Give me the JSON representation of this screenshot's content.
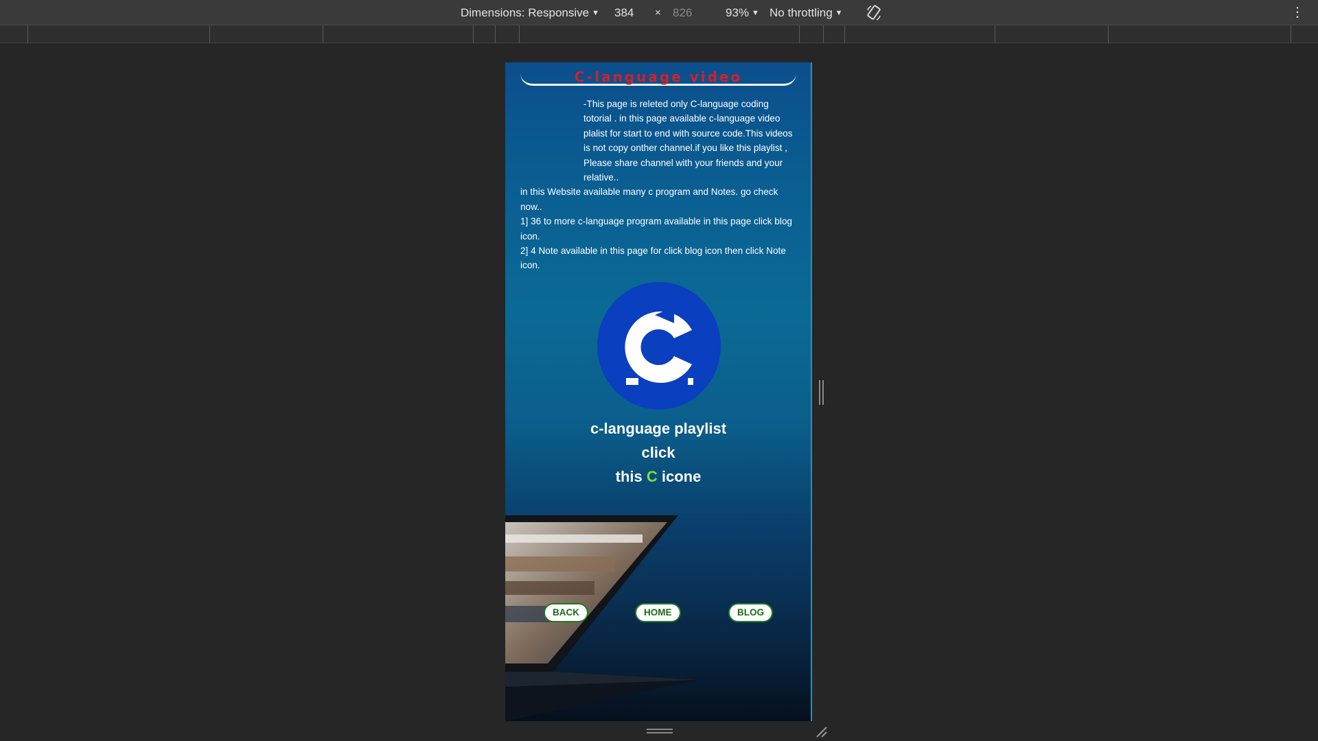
{
  "devtools": {
    "dimensions_label": "Dimensions: Responsive",
    "width": "384",
    "times": "×",
    "height": "826",
    "zoom": "93%",
    "throttle": "No throttling",
    "caret": "▼",
    "more": "⋮"
  },
  "page": {
    "title": "C-language video",
    "paragraphs": [
      "-This page is releted only C-language coding totorial . in this page available c-language video plalist for start to end with source code.This videos is not copy onther channel.if you like this playlist , Please share channel with your friends and your relative..",
      "in this Website available many c program and Notes. go check now..",
      "1] 36 to more c-language program available in this page click blog icon.",
      "2] 4 Note available in this page for click blog icon then click Note icon."
    ],
    "logo_letter": "C",
    "cta": {
      "line1": "c-language playlist",
      "line2": "click",
      "line3_pre": "this ",
      "line3_c": "C",
      "line3_post": " icone"
    },
    "buttons": {
      "back": "BACK",
      "home": "HOME",
      "blog": "BLOG"
    }
  },
  "colors": {
    "title_red": "#d4202a",
    "accent_green": "#7ee03a",
    "logo_blue": "#0a3fbf",
    "button_green": "#1f7a1f"
  },
  "icons": [
    "rotate-icon",
    "more-vertical-icon",
    "c-logo-icon"
  ]
}
